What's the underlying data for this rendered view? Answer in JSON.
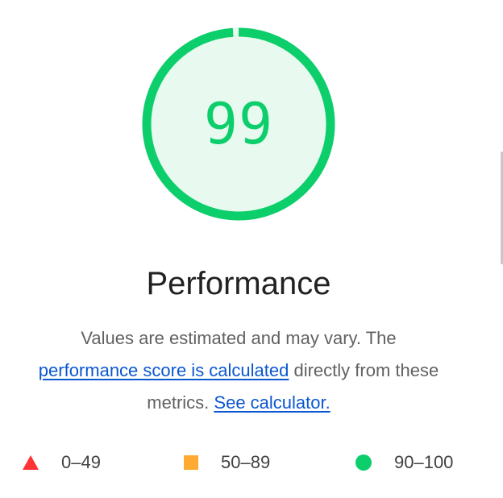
{
  "gauge": {
    "score": "99",
    "fraction": 0.99,
    "ring_color": "#0cce6b",
    "fill_color": "#e8faf0"
  },
  "category": {
    "title": "Performance"
  },
  "description": {
    "text_1": "Values are estimated and may vary. The",
    "link_1": "performance score is calculated",
    "text_2": " directly from these metrics.",
    "link_2": "See calculator."
  },
  "legend": [
    {
      "range": "0–49",
      "shape": "triangle",
      "color": "#ff3333"
    },
    {
      "range": "50–89",
      "shape": "square",
      "color": "#ffaa33"
    },
    {
      "range": "90–100",
      "shape": "circle",
      "color": "#0cce6b"
    }
  ],
  "colors": {
    "link": "#0b57d0",
    "text": "#212121",
    "muted": "#616161"
  }
}
